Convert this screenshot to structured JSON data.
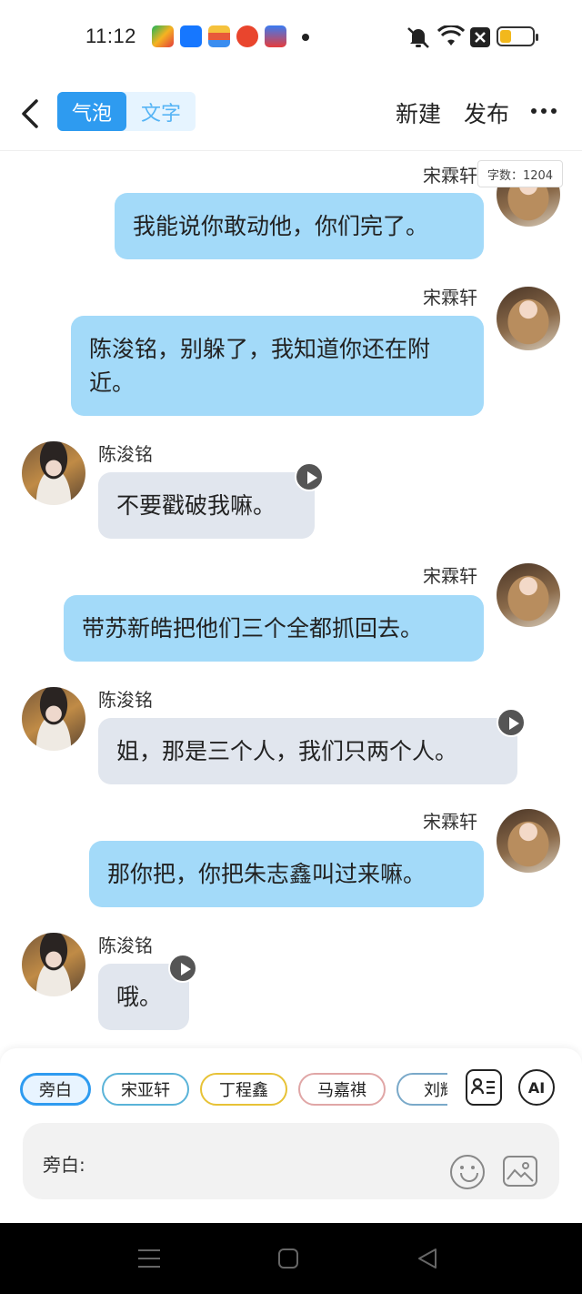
{
  "status": {
    "time": "11:12"
  },
  "header": {
    "back_icon": "chevron-left-icon",
    "tabs": [
      {
        "label": "气泡",
        "active": true
      },
      {
        "label": "文字",
        "active": false
      }
    ],
    "new_label": "新建",
    "publish_label": "发布",
    "more_icon": "more-horizontal-icon"
  },
  "word_count": "字数：1204",
  "messages": [
    {
      "side": "right",
      "sender": "宋霖轩",
      "text": "我能说你敢动他，你们完了。",
      "voice": false
    },
    {
      "side": "right",
      "sender": "宋霖轩",
      "text": "陈浚铭，别躲了，我知道你还在附近。",
      "voice": false
    },
    {
      "side": "left",
      "sender": "陈浚铭",
      "text": "不要戳破我嘛。",
      "voice": true
    },
    {
      "side": "right",
      "sender": "宋霖轩",
      "text": "带苏新皓把他们三个全都抓回去。",
      "voice": false
    },
    {
      "side": "left",
      "sender": "陈浚铭",
      "text": "姐，那是三个人，我们只两个人。",
      "voice": true
    },
    {
      "side": "right",
      "sender": "宋霖轩",
      "text": "那你把，你把朱志鑫叫过来嘛。",
      "voice": false
    },
    {
      "side": "left",
      "sender": "陈浚铭",
      "text": "哦。",
      "voice": true
    }
  ],
  "roles": [
    {
      "label": "旁白",
      "color": "#2e9bf0",
      "selected": true
    },
    {
      "label": "宋亚轩",
      "color": "#5ab3d8",
      "selected": false
    },
    {
      "label": "丁程鑫",
      "color": "#e7c236",
      "selected": false
    },
    {
      "label": "马嘉祺",
      "color": "#e0a6a6",
      "selected": false
    },
    {
      "label": "刘耀",
      "color": "#7aa9c9",
      "selected": false
    }
  ],
  "tools": {
    "roles_icon": "contact-card-icon",
    "ai_label": "AI"
  },
  "input": {
    "label": "旁白:",
    "emoji_icon": "emoji-icon",
    "image_icon": "image-icon"
  },
  "colors": {
    "accent": "#2e9bf0",
    "bubble_me": "#a3daf9",
    "bubble_other": "#e1e6ee"
  }
}
